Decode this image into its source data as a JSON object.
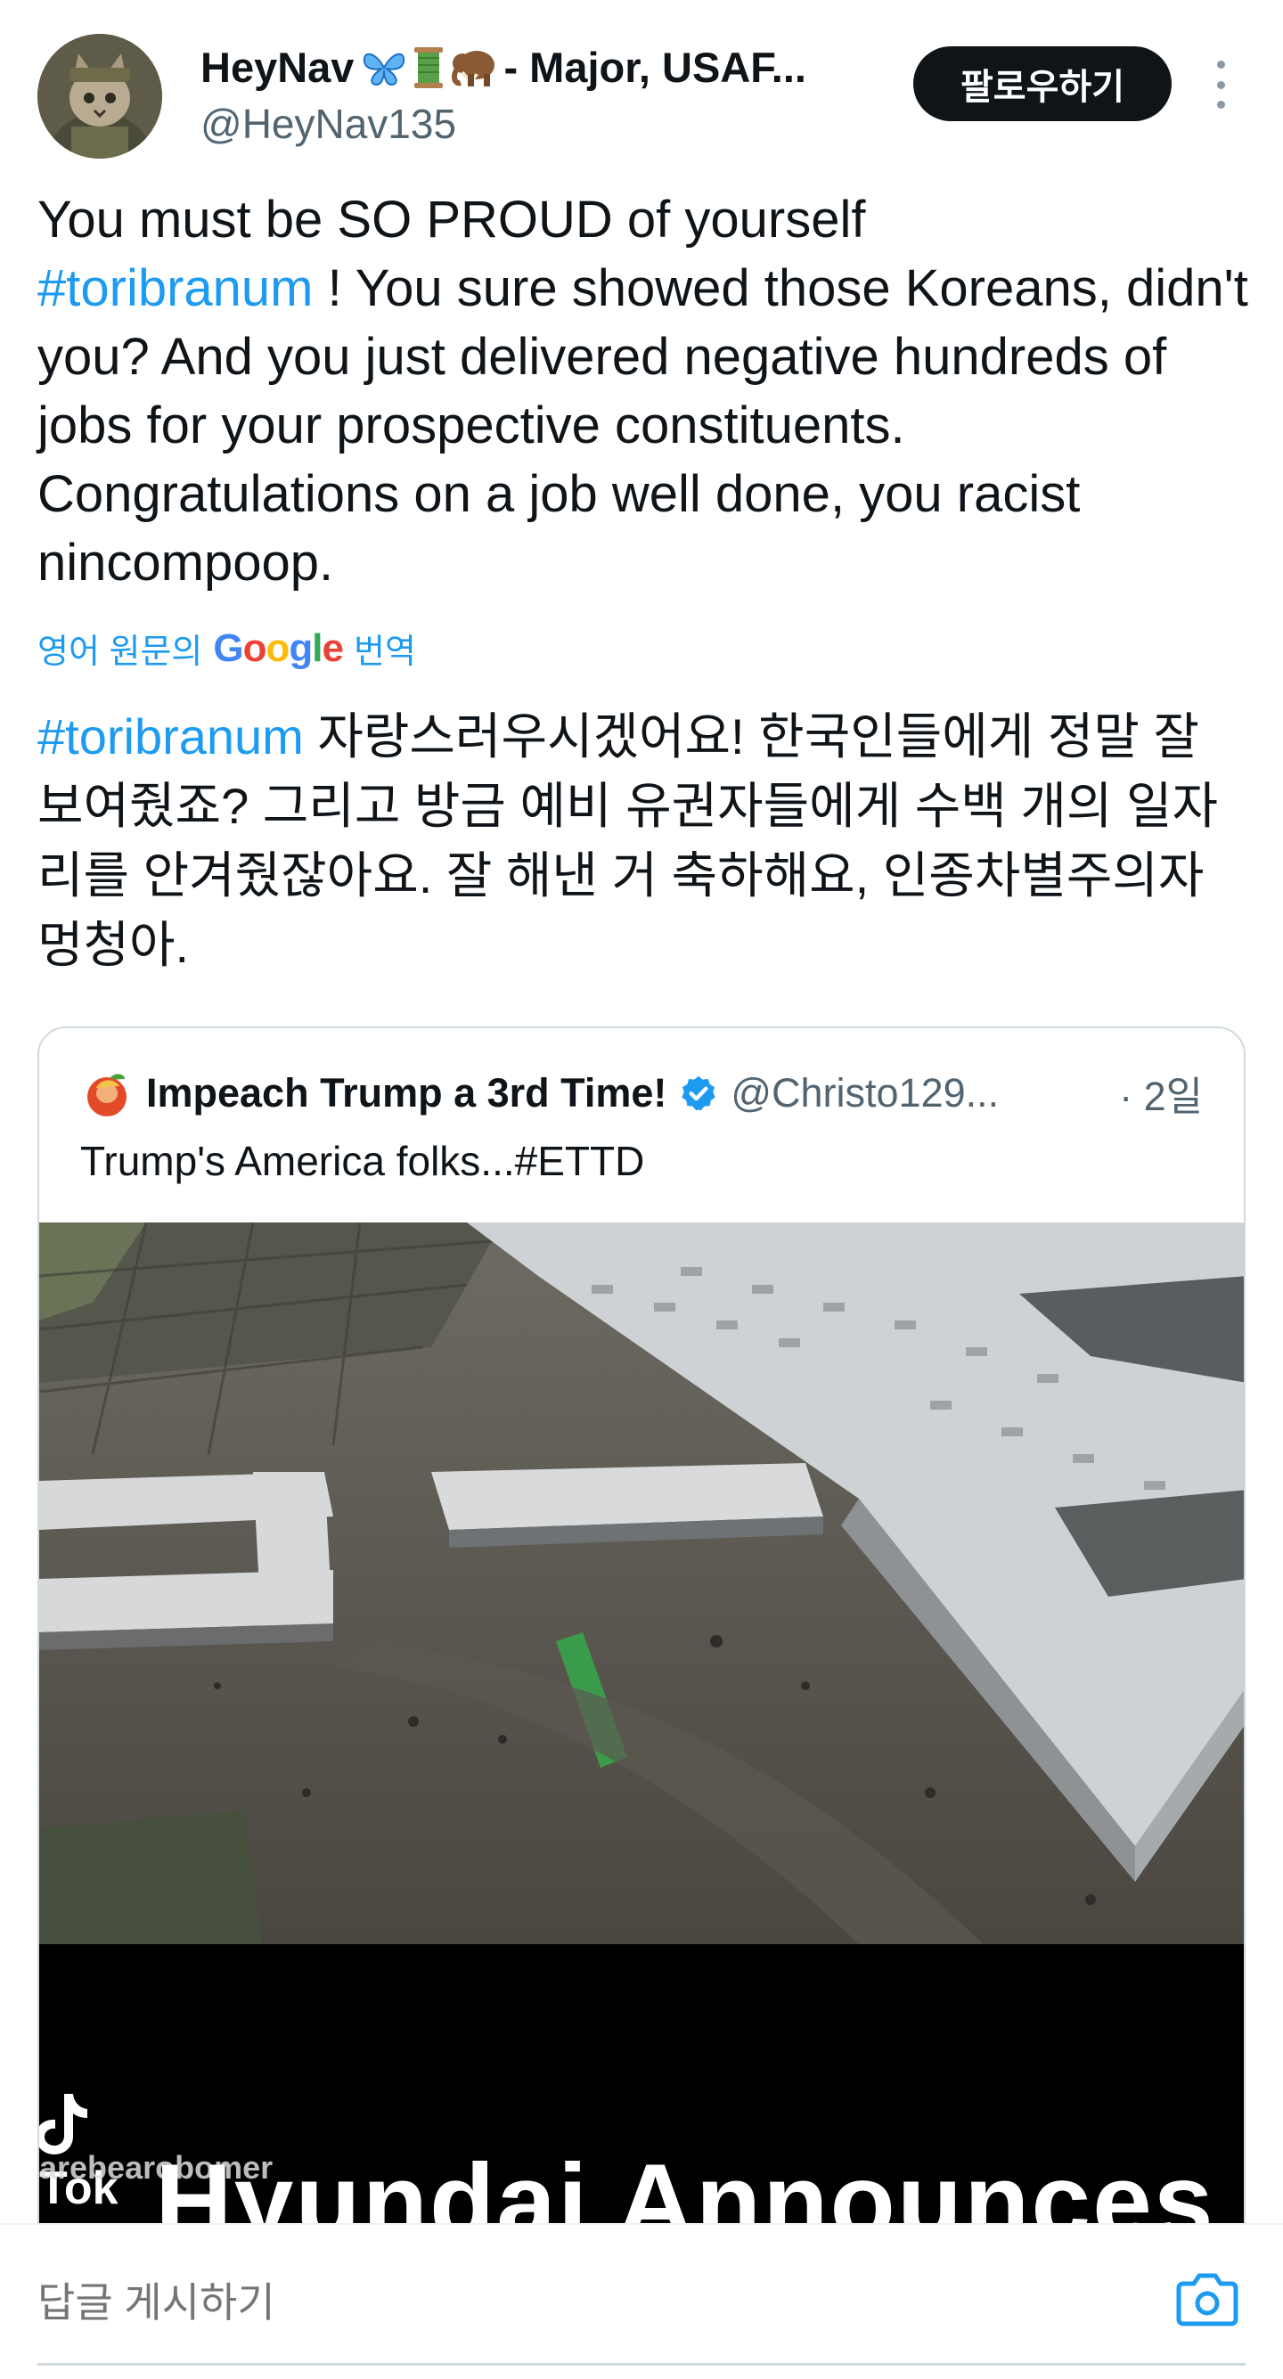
{
  "author": {
    "display_name": "HeyNav",
    "name_suffix": " - Major, USAF...",
    "emoji_icons": [
      "butterfly-icon",
      "thread-spool-icon",
      "mammoth-icon"
    ],
    "handle": "@HeyNav135",
    "avatar_icon": "cat-soldier-avatar"
  },
  "follow_label": "팔로우하기",
  "post": {
    "line1": "You must be SO PROUD of yourself",
    "hashtag": "#toribranum",
    "rest": " ! You sure showed those Koreans, didn't you? And you just delivered negative hundreds of jobs for your prospective constituents. Congratulations on a job well done, you racist nincompoop."
  },
  "translate": {
    "prefix": "영어 원문의",
    "brand": "Google",
    "suffix": "번역"
  },
  "translated": {
    "hashtag": "#toribranum",
    "text": " 자랑스러우시겠어요! 한국인들에게 정말 잘 보여줬죠? 그리고 방금 예비 유권자들에게 수백 개의 일자리를 안겨줬잖아요. 잘 해낸 거 축하해요, 인종차별주의자 멍청아."
  },
  "quote": {
    "name": "Impeach Trump a 3rd Time!",
    "handle": "@Christo129...",
    "time": "· 2일",
    "text": "Trump's America folks...#ETTD",
    "media_caption": "Hyundai Announces",
    "tiktok_label": "Tok",
    "tiktok_user": "arebearobomer"
  },
  "reply": {
    "placeholder": "답글 게시하기"
  },
  "colors": {
    "link": "#1d9bf0",
    "text": "#0f1419",
    "secondary": "#536471",
    "verified": "#1d9bf0"
  }
}
